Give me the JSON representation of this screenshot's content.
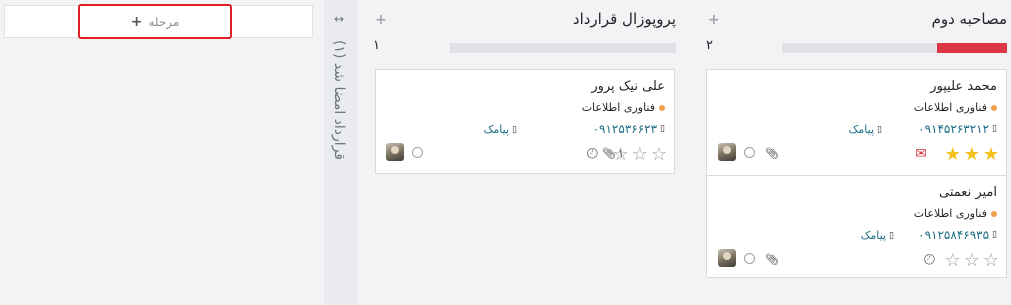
{
  "add_stage": {
    "label": "مرحله",
    "plus": "+"
  },
  "folded_stage": {
    "arrows": "↔",
    "title": "قرارداد امضا شد (۱)"
  },
  "stages": [
    {
      "title": "مصاحبه دوم",
      "count": "۲",
      "plus": "+",
      "progress_red_fraction": 0.31,
      "cards": [
        {
          "name": "محمد علیپور",
          "tag": "فناوری اطلاعات",
          "phone": "۰۹۱۴۵۲۶۳۲۱۲",
          "sms": "پیامک",
          "stars": 3,
          "activity": "envelope",
          "attachments": ""
        },
        {
          "name": "امیر نعمتی",
          "tag": "فناوری اطلاعات",
          "phone": "۰۹۱۲۵۸۴۶۹۳۵",
          "sms": "پیامک",
          "stars": 0,
          "activity": "clock",
          "attachments": ""
        }
      ]
    },
    {
      "title": "پروپوزال قرارداد",
      "count": "۱",
      "plus": "+",
      "progress_red_fraction": 0,
      "cards": [
        {
          "name": "علی نیک پرور",
          "tag": "فناوری اطلاعات",
          "phone": "۰۹۱۲۵۳۶۶۲۳",
          "sms": "پیامک",
          "stars": 0,
          "activity": "clock",
          "attachments": "۱"
        }
      ]
    }
  ],
  "colors": {
    "accent_red": "#dc3545",
    "star_yellow": "#f3c01a",
    "link_teal": "#1b6d85",
    "highlight_outline": "#e01f26"
  }
}
